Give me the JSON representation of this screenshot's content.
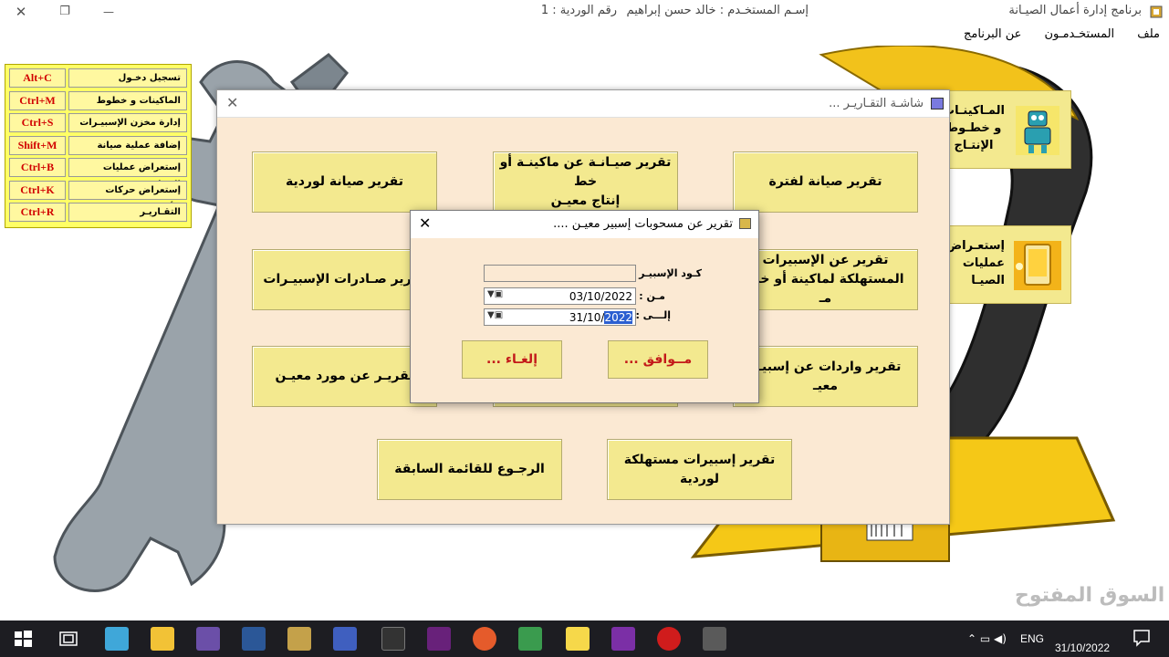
{
  "titlebar": {
    "app_title": "برنامج إدارة أعمال الصيـانة",
    "user": "إسـم المستخـدم : خالد حسن إبراهيم",
    "shift": "رقم الوردية : 1",
    "close_glyph": "✕",
    "restore_glyph": "❐",
    "minimize_glyph": "—"
  },
  "menubar": {
    "items": [
      "ملف",
      "المستخـدمـون",
      "عن البرنامج"
    ]
  },
  "shortcuts": [
    {
      "label": "تسجيل دخـول",
      "key": "Alt+C"
    },
    {
      "label": "الماكينات و خطوط الإنتاج",
      "key": "Ctrl+M"
    },
    {
      "label": "إدارة مخزن الإسبيـرات",
      "key": "Ctrl+S"
    },
    {
      "label": "إضافة عملية صيانة",
      "key": "Shift+M"
    },
    {
      "label": "إستعراض عمليات الصيانة",
      "key": "Ctrl+B"
    },
    {
      "label": "إستعراض حركات الأصنـاف",
      "key": "Ctrl+K"
    },
    {
      "label": "التقـاريـر",
      "key": "Ctrl+R"
    }
  ],
  "side_tiles": {
    "machines": "المـاكينـات\nو خطـوط\nالإنتـاج",
    "operations": "إستعـراض\nعمليات\nالصيـا"
  },
  "reports_window": {
    "title": "شاشـة التقـاريـر ...",
    "close_glyph": "✕",
    "buttons": {
      "period": "تقرير صيانة لفترة",
      "machine": "تقرير صيـانـة عن ماكينـة أو خط\nإنتاج معيـن",
      "shift": "تقرير صيانة لوردية",
      "consumed": "تقرير عن الإسبيرات\nالمستهلكة   لماكينة أو خط مـ",
      "issued": "تقرير صـادرات الإسبيـرات",
      "incoming": "تقرير واردات عن إسبيـر معيـ",
      "supplier": "تقريـر عن مورد معيـن",
      "consumed_shift": "تقرير إسبيرات مستهلكة لوردية",
      "back": "الرجـوع للقائمة السابقة"
    }
  },
  "dialog": {
    "title": "تقرير عن مسحوبات إسبير معيـن ....",
    "close_glyph": "✕",
    "code_label": "كـود الإسبيـر :",
    "from_label": "مـن :",
    "to_label": "إلـــى :",
    "code_value": "",
    "from_value": "03/10/2022",
    "to_value_prefix": "31/10/",
    "to_value_selected": "2022",
    "ok_label": "مــوافق ...",
    "cancel_label": "إلغـاء ..."
  },
  "taskbar": {
    "lang": "ENG",
    "time": "",
    "date": "31/10/2022"
  },
  "watermark": "السوق المفتوح",
  "colors": {
    "tile_yellow": "#f3e98f",
    "window_bg": "#fbe9d3",
    "shortcut_key_red": "#d10000",
    "taskbar": "#1d1d22"
  }
}
